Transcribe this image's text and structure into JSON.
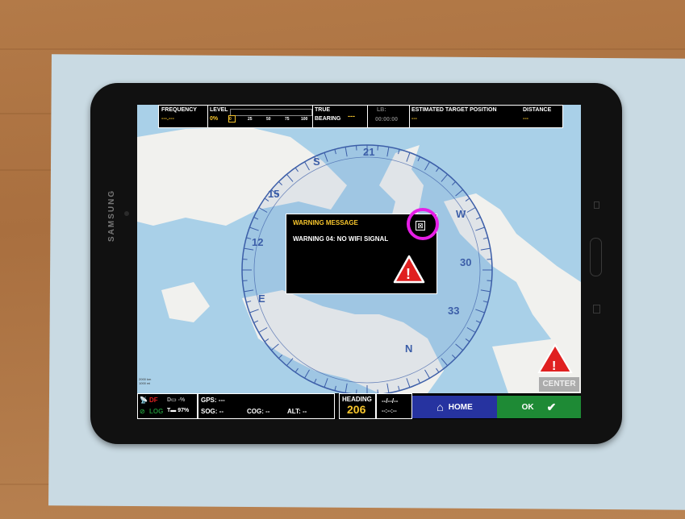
{
  "device": {
    "brand": "SAMSUNG"
  },
  "top_bar": {
    "frequency_label": "FREQUENCY",
    "frequency_value": "---.---",
    "level_label": "LEVEL",
    "level_value": "0%",
    "level_ticks": [
      "0",
      "25",
      "50",
      "75",
      "100"
    ],
    "true_bearing_label_1": "TRUE",
    "true_bearing_label_2": "BEARING",
    "true_bearing_value": "---",
    "lb_label": "LB:",
    "lb_time": "00:00:00",
    "estimated_target_label": "ESTIMATED TARGET POSITION",
    "estimated_target_value": "---",
    "distance_label": "DISTANCE",
    "distance_value": "---"
  },
  "compass": {
    "labels": [
      "S",
      "21",
      "15",
      "12",
      "W",
      "30",
      "33",
      "N",
      "E"
    ]
  },
  "dialog": {
    "title": "WARNING MESSAGE",
    "message": "WARNING 04: NO WIFI SIGNAL",
    "close_symbol": "⊠",
    "warning_symbol": "!"
  },
  "map_overlay": {
    "center_label": "CENTER",
    "warning_symbol": "!",
    "scale_1": "2000 km",
    "scale_2": "1000 mi"
  },
  "bottom_bar": {
    "df_label": "DF",
    "df_battery": "D▭ -%",
    "log_label": "LOG",
    "log_battery": "T▬ 97%",
    "gps_label": "GPS: ---",
    "sog_label": "SOG: --",
    "cog_label": "COG: --",
    "alt_label": "ALT: --",
    "heading_label": "HEADING",
    "heading_value": "206",
    "date_value": "--/--/--",
    "time_value": "--:--:--",
    "home_label": "HOME",
    "ok_label": "OK"
  },
  "colors": {
    "accent_yellow": "#f7c52c",
    "home_blue": "#2633a0",
    "ok_green": "#1e8a35",
    "warning_red": "#e02020",
    "highlight_magenta": "#e61ee6"
  }
}
